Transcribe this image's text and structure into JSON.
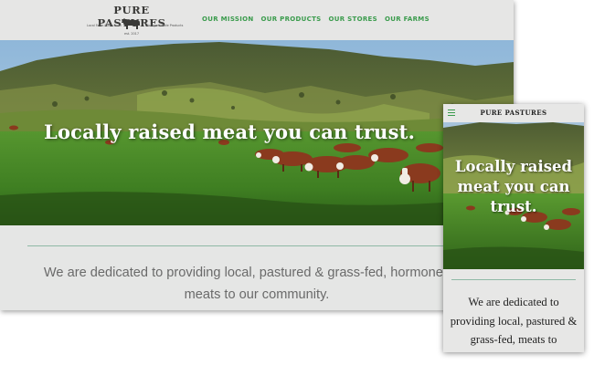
{
  "desktop": {
    "logo": {
      "title": "PURE PASTURES",
      "tagline_left": "Local Farm-Fresh Food",
      "tagline_right": "Michigan-Made Products",
      "established": "est. 2017",
      "icon": "cow-icon"
    },
    "nav": [
      {
        "label": "OUR MISSION"
      },
      {
        "label": "OUR PRODUCTS"
      },
      {
        "label": "OUR STORES"
      },
      {
        "label": "OUR FARMS"
      }
    ],
    "hero_headline": "Locally raised meat you can trust.",
    "mission_text": "We are dedicated to providing local, pastured & grass-fed, hormone free meats to our community."
  },
  "mobile": {
    "menu_icon": "hamburger-menu-icon",
    "title": "PURE PASTURES",
    "hero_headline": "Locally raised meat you can trust.",
    "mission_text": "We are dedicated to providing local, pastured & grass-fed,  meats to"
  },
  "colors": {
    "nav_green": "#3a9b4c",
    "page_bg": "#e5e6e5",
    "mission_text_gray": "#6a6a6a",
    "divider": "#8fb9a6"
  }
}
